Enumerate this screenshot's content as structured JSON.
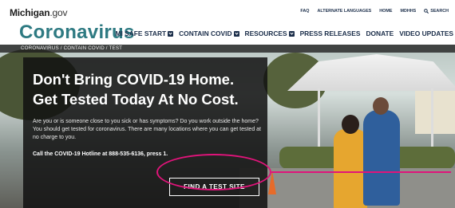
{
  "utility_bar": {
    "logo_main": "Michigan",
    "logo_suffix": ".gov",
    "links": [
      "FAQ",
      "ALTERNATE LANGUAGES",
      "HOME",
      "MDHHS",
      "SEARCH"
    ],
    "search_icon": "search-icon"
  },
  "header": {
    "site_title": "Coronavirus",
    "nav": [
      {
        "label": "MI SAFE START",
        "has_dropdown": true
      },
      {
        "label": "CONTAIN COVID",
        "has_dropdown": true
      },
      {
        "label": "RESOURCES",
        "has_dropdown": true
      },
      {
        "label": "PRESS RELEASES",
        "has_dropdown": false
      },
      {
        "label": "DONATE",
        "has_dropdown": false
      },
      {
        "label": "VIDEO UPDATES",
        "has_dropdown": false
      }
    ]
  },
  "breadcrumb": "CORONAVIRUS  /  CONTAIN COVID  /  TEST",
  "hero": {
    "headline_line1": "Don't Bring COVID-19 Home.",
    "headline_line2": "Get Tested Today At No Cost.",
    "body": "Are you or is someone close to you sick or has symptoms? Do you work outside the home? You should get tested for coronavirus. There are many locations where you can get tested at no charge to you.",
    "hotline": "Call the COVID-19 Hotline at 888-535-6136, press 1.",
    "cta_label": "FIND A TEST SITE"
  },
  "colors": {
    "title_teal": "#2e7a82",
    "nav_navy": "#1b2e4a",
    "annotation_pink": "#e0147a"
  }
}
